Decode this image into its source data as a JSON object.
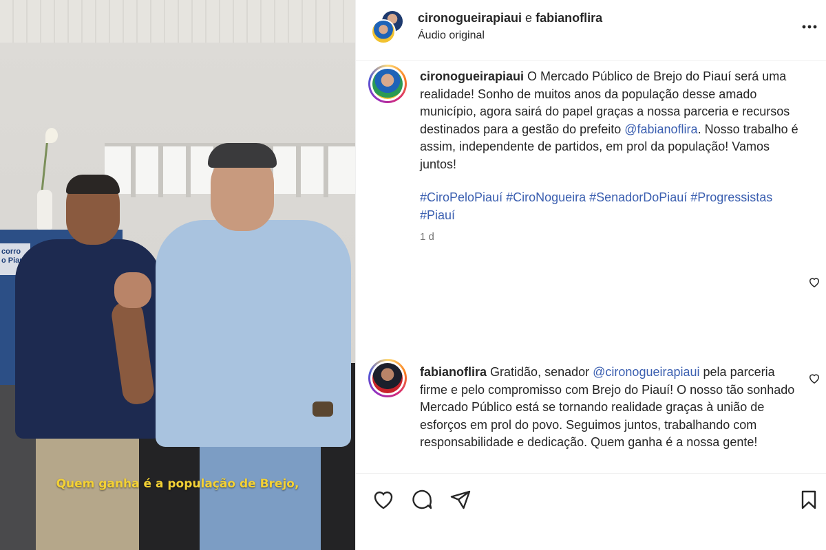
{
  "video": {
    "subtitle": "Quem ganha é a população de Brejo,",
    "cabinet_label": "corro\no Piau"
  },
  "header": {
    "user1": "cironogueirapiaui",
    "connector": "e",
    "user2": "fabianoflira",
    "audio": "Áudio original",
    "more_icon": "more-horizontal-icon"
  },
  "caption": {
    "username": "cironogueirapiaui",
    "text_before": "O Mercado Público de Brejo do Piauí será uma realidade! Sonho de muitos anos da população desse amado município, agora sairá do papel graças a nossa parceria e recursos destinados para a gestão do prefeito",
    "mention": "@fabianoflira",
    "text_after": ". Nosso trabalho é assim, independente de partidos, em prol da população! Vamos juntos!",
    "hashtags": "#CiroPeloPiauí #CiroNogueira #SenadorDoPiauí #Progressistas #Piauí",
    "time": "1 d"
  },
  "comment": {
    "username": "fabianoflira",
    "text_before": "Gratidão, senador",
    "mention": "@cironogueirapiaui",
    "text_after": "pela parceria firme e pelo compromisso com Brejo do Piauí! O nosso tão sonhado Mercado Público está se tornando realidade graças à união de esforços em prol do povo. Seguimos juntos, trabalhando com responsabilidade e dedicação. Quem ganha é a nossa gente!"
  },
  "actions": {
    "like": "heart-icon",
    "comment": "comment-icon",
    "share": "send-icon",
    "save": "bookmark-icon"
  },
  "colors": {
    "link": "#3b5fb0",
    "subtitle": "#f3d135",
    "text": "#262626",
    "muted": "#737373"
  }
}
